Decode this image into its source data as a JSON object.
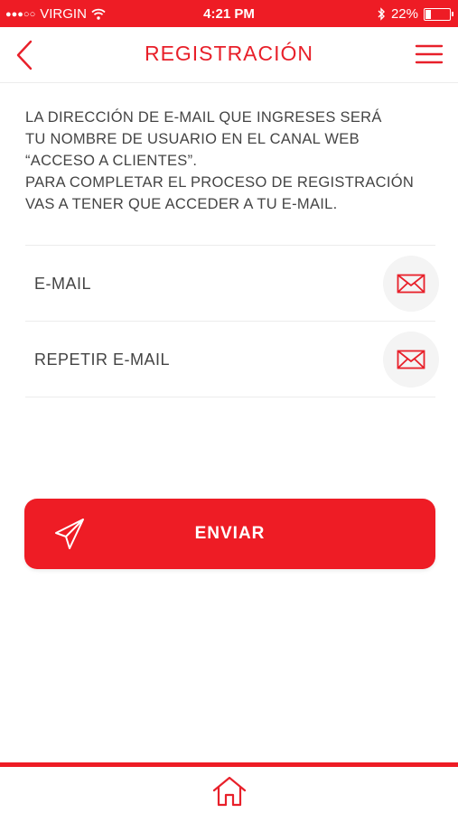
{
  "status_bar": {
    "carrier": "VIRGIN",
    "time": "4:21 PM",
    "battery": "22%",
    "battery_level": 0.22,
    "icons": [
      "signal-dots-icon",
      "wifi-icon",
      "bluetooth-icon",
      "battery-icon"
    ]
  },
  "nav": {
    "title": "REGISTRACIÓN",
    "back_icon": "chevron-left-icon",
    "menu_icon": "hamburger-menu-icon"
  },
  "intro": {
    "lines": [
      "LA DIRECCIÓN DE E-MAIL QUE INGRESES SERÁ",
      "TU NOMBRE DE USUARIO EN EL CANAL WEB",
      "“ACCESO A CLIENTES”.",
      "PARA COMPLETAR EL PROCESO DE REGISTRACIÓN",
      "VAS A TENER QUE ACCEDER A TU E-MAIL."
    ]
  },
  "form": {
    "email_placeholder": "E-MAIL",
    "email_value": "",
    "repeat_email_placeholder": "REPETIR E-MAIL",
    "repeat_email_value": "",
    "field_icon": "envelope-icon"
  },
  "send_button": {
    "label": "ENVIAR",
    "icon": "paper-plane-icon"
  },
  "tab_bar": {
    "home_icon": "home-icon"
  },
  "colors": {
    "brand": "#ee1c25",
    "text": "#444444",
    "divider": "#ececec"
  }
}
